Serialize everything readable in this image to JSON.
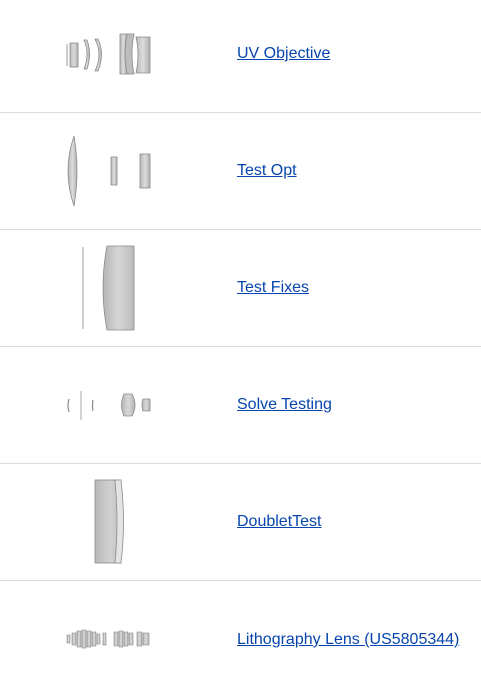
{
  "lenses": [
    {
      "name": "UV Objective",
      "thumbnail": "uv-objective-lens-diagram"
    },
    {
      "name": "Test Opt",
      "thumbnail": "test-opt-lens-diagram"
    },
    {
      "name": "Test Fixes",
      "thumbnail": "test-fixes-lens-diagram"
    },
    {
      "name": "Solve Testing",
      "thumbnail": "solve-testing-lens-diagram"
    },
    {
      "name": "DoubletTest",
      "thumbnail": "doublet-test-lens-diagram"
    },
    {
      "name": "Lithography Lens (US5805344)",
      "thumbnail": "lithography-lens-diagram"
    }
  ],
  "colors": {
    "link": "#0645ad",
    "divider": "#dcdcdc",
    "lens_fill": "#c8c8c8",
    "lens_stroke": "#8a8a8a"
  }
}
